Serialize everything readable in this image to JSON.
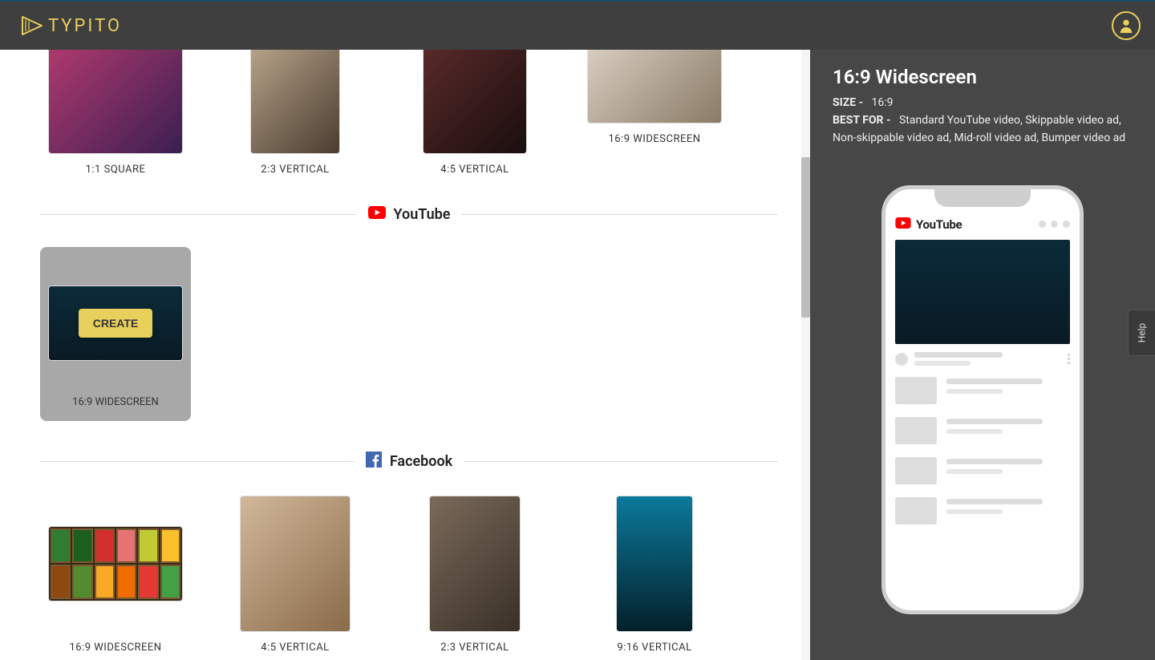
{
  "brand": {
    "name": "TYPITO"
  },
  "help": {
    "label": "Help"
  },
  "top_row": {
    "items": [
      {
        "label": "1:1 SQUARE"
      },
      {
        "label": "2:3 VERTICAL"
      },
      {
        "label": "4:5 VERTICAL"
      },
      {
        "label": "16:9 WIDESCREEN"
      }
    ]
  },
  "sections": {
    "youtube": {
      "title": "YouTube",
      "selected": {
        "label": "16:9 WIDESCREEN",
        "action": "CREATE"
      }
    },
    "facebook": {
      "title": "Facebook",
      "items": [
        {
          "label": "16:9 WIDESCREEN"
        },
        {
          "label": "4:5 VERTICAL"
        },
        {
          "label": "2:3 VERTICAL"
        },
        {
          "label": "9:16 VERTICAL"
        }
      ]
    }
  },
  "detail": {
    "title": "16:9 Widescreen",
    "size_label": "SIZE -",
    "size_value": "16:9",
    "bestfor_label": "BEST FOR -",
    "bestfor_value": "Standard YouTube video, Skippable video ad, Non-skippable video ad, Mid-roll video ad, Bumper video ad",
    "phone_brand": "YouTube"
  }
}
